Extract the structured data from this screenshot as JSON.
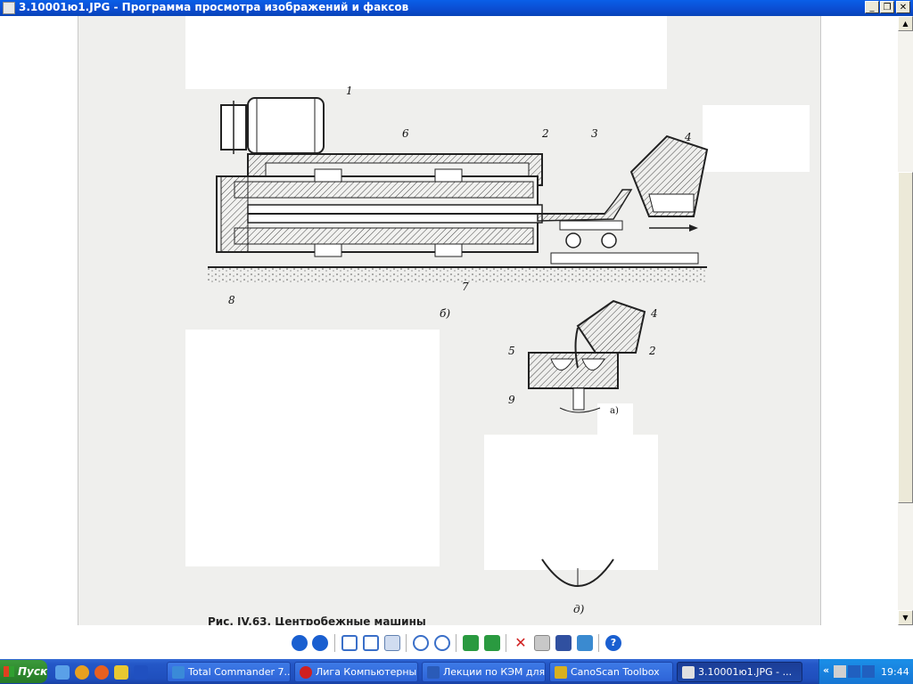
{
  "window": {
    "title": "3.10001ю1.JPG - Программа просмотра изображений и факсов",
    "controls": {
      "minimize": "_",
      "maximize": "❐",
      "close": "✕"
    }
  },
  "figure": {
    "labels": [
      "1",
      "6",
      "2",
      "3",
      "4",
      "8",
      "7",
      "б)",
      "4",
      "5",
      "2",
      "9",
      "а)",
      "д)"
    ],
    "caption": "Рис. IV.63. Центробежные машины"
  },
  "viewer_toolbar": {
    "icons": [
      "prev-image-icon",
      "next-image-icon",
      "best-fit-icon",
      "actual-size-icon",
      "slideshow-icon",
      "zoom-in-icon",
      "zoom-out-icon",
      "rotate-clockwise-icon",
      "rotate-counterclockwise-icon",
      "delete-icon",
      "print-icon",
      "save-icon",
      "edit-icon",
      "help-icon"
    ]
  },
  "taskbar": {
    "start_label": "Пуск",
    "tasks": [
      {
        "label": "Total Commander 7....",
        "icon": "total-commander-icon",
        "color": "#3a8ad8"
      },
      {
        "label": "Лига Компьютерны...",
        "icon": "opera-icon",
        "color": "#d02020"
      },
      {
        "label": "Лекции по КЭМ для...",
        "icon": "word-icon",
        "color": "#2a5bb8"
      },
      {
        "label": "CanoScan Toolbox",
        "icon": "canoscan-icon",
        "color": "#d8b020"
      },
      {
        "label": "3.10001ю1.JPG - ...",
        "icon": "image-viewer-icon",
        "color": "#e0e0e0",
        "active": true
      }
    ],
    "clock": "19:44",
    "tray_chevron": "«"
  }
}
